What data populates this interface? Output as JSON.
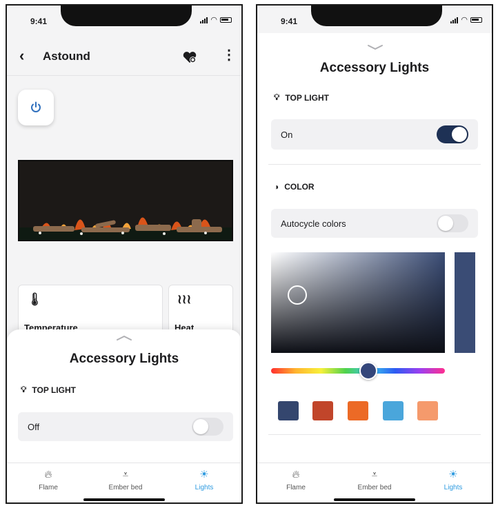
{
  "status": {
    "time": "9:41"
  },
  "device": {
    "name": "Astound"
  },
  "cards": [
    {
      "label": "Temperature",
      "icon": "thermometer-icon"
    },
    {
      "label": "Heat",
      "icon": "heat-waves-icon"
    }
  ],
  "left_sheet": {
    "title": "Accessory Lights",
    "top_light_label": "TOP LIGHT",
    "top_light_state": "Off",
    "top_light_on": false
  },
  "right_sheet": {
    "title": "Accessory Lights",
    "top_light_label": "TOP LIGHT",
    "top_light_state": "On",
    "top_light_on": true,
    "color_label": "COLOR",
    "autocycle_label": "Autocycle colors",
    "autocycle_on": false,
    "selected_color": "#3a4c75",
    "swatches": [
      "#34466e",
      "#c1452a",
      "#ec6a26",
      "#4aa6db",
      "#f59a6c"
    ]
  },
  "tabs": [
    {
      "label": "Flame",
      "icon": "flame-icon"
    },
    {
      "label": "Ember bed",
      "icon": "ember-bed-icon"
    },
    {
      "label": "Lights",
      "icon": "sun-icon",
      "active": true
    }
  ],
  "colors": {
    "accent": "#2f9be0",
    "toggle_on": "#1e3155"
  }
}
